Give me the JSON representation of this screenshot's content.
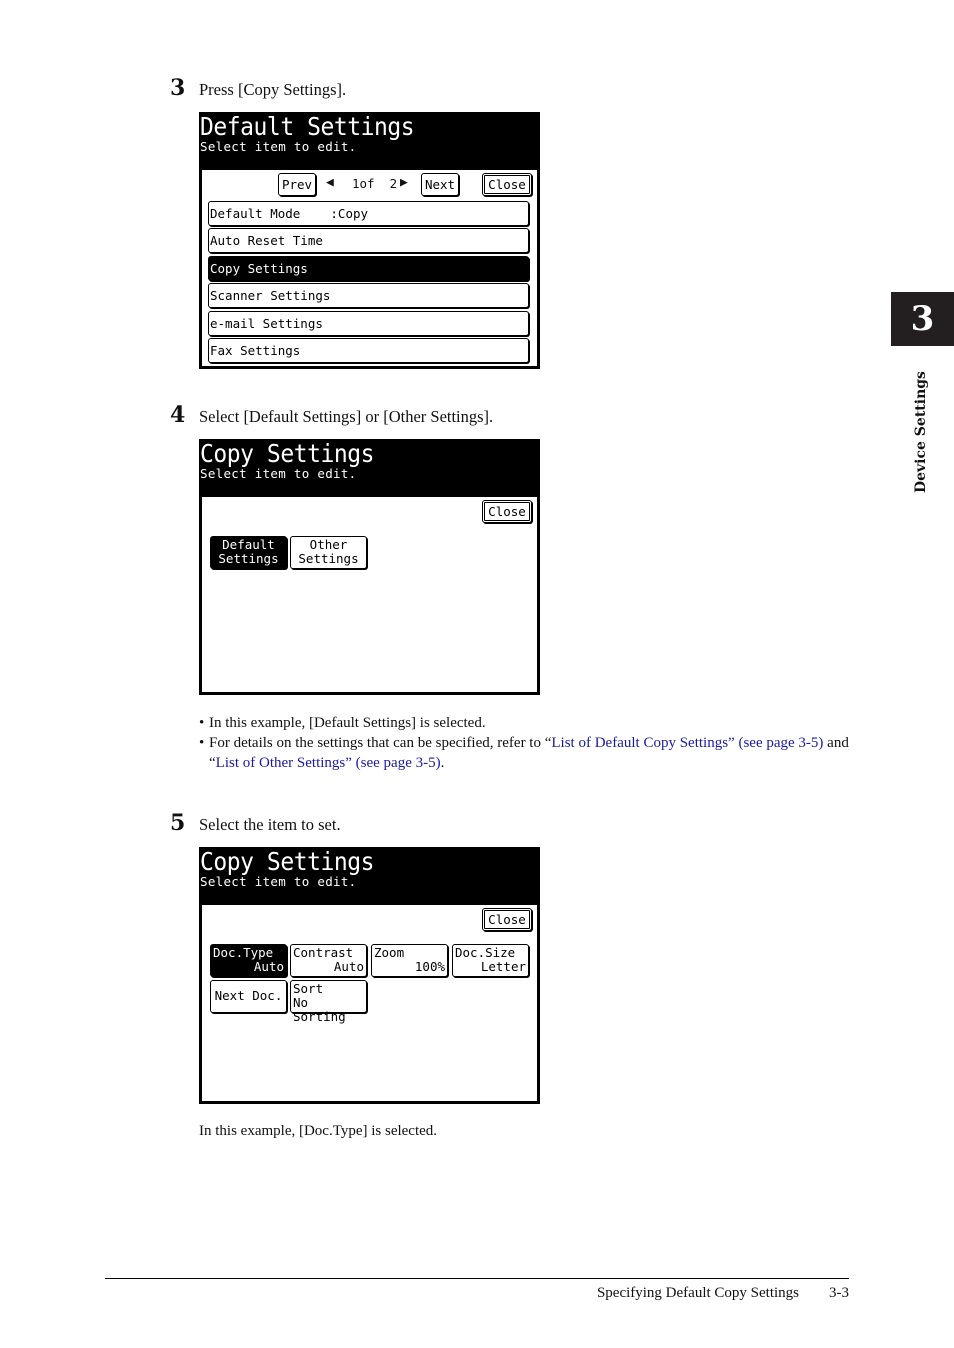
{
  "chapter": {
    "number": "3",
    "label": "Device Settings"
  },
  "steps": [
    {
      "number": "3",
      "text": "Press [Copy Settings].",
      "screen": {
        "title": "Default Settings",
        "subtitle": "Select item to edit.",
        "nav": {
          "prev": "Prev",
          "page_indicator": "1of  2",
          "next": "Next",
          "close": "Close"
        },
        "items": [
          {
            "label": "Default Mode    :Copy",
            "selected": false
          },
          {
            "label": "Auto Reset Time",
            "selected": false
          },
          {
            "label": "Copy Settings",
            "selected": true
          },
          {
            "label": "Scanner Settings",
            "selected": false
          },
          {
            "label": "e-mail Settings",
            "selected": false
          },
          {
            "label": "Fax Settings",
            "selected": false
          }
        ]
      }
    },
    {
      "number": "4",
      "text": "Select [Default Settings] or [Other Settings].",
      "screen": {
        "title": "Copy Settings",
        "subtitle": "Select item to edit.",
        "close": "Close",
        "buttons": [
          {
            "line1": "Default",
            "line2": "Settings",
            "selected": true
          },
          {
            "line1": "Other",
            "line2": "Settings",
            "selected": false
          }
        ]
      },
      "notes": {
        "bullet1": "In this example, [Default Settings] is selected.",
        "bullet2_prefix": "For details on the settings that can be specified, refer to “",
        "link1": "List of Default Copy Settings",
        "link1_ref": "” (see page 3-5)",
        "and": " and “",
        "link2": "List of Other Settings",
        "link2_ref": "” (see page 3-5)",
        "end": "."
      }
    },
    {
      "number": "5",
      "text": "Select the item to set.",
      "screen": {
        "title": "Copy Settings",
        "subtitle": "Select item to edit.",
        "close": "Close",
        "buttons": [
          {
            "name": "Doc.Type",
            "value": "Auto",
            "selected": true
          },
          {
            "name": "Contrast",
            "value": "Auto",
            "selected": false
          },
          {
            "name": "Zoom",
            "value": "100%",
            "selected": false
          },
          {
            "name": "Doc.Size",
            "value": "Letter",
            "selected": false
          },
          {
            "name": "Next Doc.",
            "value": "",
            "selected": false
          },
          {
            "name": "Sort",
            "value": "No Sorting",
            "selected": false
          }
        ]
      },
      "note": "In this example, [Doc.Type] is selected."
    }
  ],
  "footer": {
    "section": "Specifying Default Copy Settings",
    "page": "3-3"
  }
}
